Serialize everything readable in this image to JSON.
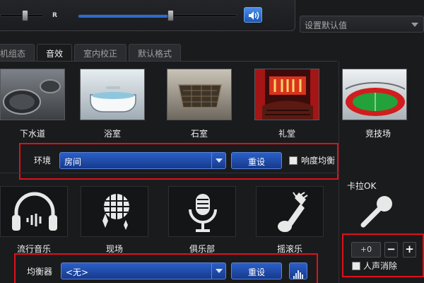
{
  "top": {
    "balance_right_label": "R",
    "default_select_value": "设置默认值",
    "speaker_icon": "speaker-icon"
  },
  "tabs": [
    {
      "label": "扬声器组态",
      "visible_label": "机组态",
      "active": false
    },
    {
      "label": "音效",
      "active": true
    },
    {
      "label": "室内校正",
      "active": false
    },
    {
      "label": "默认格式",
      "active": false
    }
  ],
  "environments": [
    {
      "label": "下水道",
      "icon": "sewer-icon"
    },
    {
      "label": "浴室",
      "icon": "bathtub-icon"
    },
    {
      "label": "石室",
      "icon": "stone-room-icon"
    },
    {
      "label": "礼堂",
      "icon": "auditorium-icon"
    },
    {
      "label": "竞技场",
      "icon": "stadium-icon"
    }
  ],
  "environment_bar": {
    "label": "环境",
    "selected": "房间",
    "reset_label": "重设",
    "loudness_label": "响度均衡"
  },
  "genres": [
    {
      "label": "流行音乐",
      "icon": "headphones-icon"
    },
    {
      "label": "现场",
      "icon": "disco-ball-icon"
    },
    {
      "label": "俱乐部",
      "icon": "microphone-icon"
    },
    {
      "label": "摇滚乐",
      "icon": "guitar-icon"
    }
  ],
  "equalizer_bar": {
    "label": "均衡器",
    "selected": "<无>",
    "reset_label": "重设",
    "eq_icon": "equalizer-icon"
  },
  "karaoke": {
    "title": "卡拉OK",
    "icon": "karaoke-mic-icon",
    "value": "+0",
    "minus": "−",
    "plus": "+",
    "voice_cancel_label": "人声消除"
  },
  "colors": {
    "accent_blue": "#2a5fc8",
    "highlight_red": "#e0101a",
    "background": "#1a1b1d"
  }
}
